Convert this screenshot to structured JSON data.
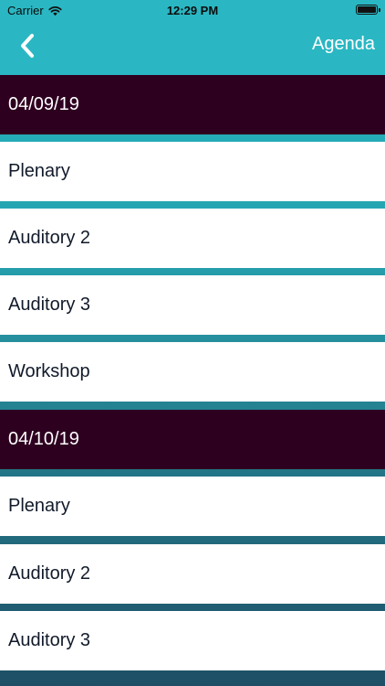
{
  "status_bar": {
    "carrier": "Carrier",
    "time": "12:29 PM"
  },
  "nav": {
    "title": "Agenda",
    "back_icon": "chevron-left-icon"
  },
  "agenda": [
    {
      "date": "04/09/19",
      "rooms": [
        "Plenary",
        "Auditory 2",
        "Auditory 3",
        "Workshop"
      ]
    },
    {
      "date": "04/10/19",
      "rooms": [
        "Plenary",
        "Auditory 2",
        "Auditory 3"
      ]
    }
  ],
  "colors": {
    "header": "#2ab7c3",
    "date_header": "#2e0020",
    "row_text": "#111a2a"
  }
}
